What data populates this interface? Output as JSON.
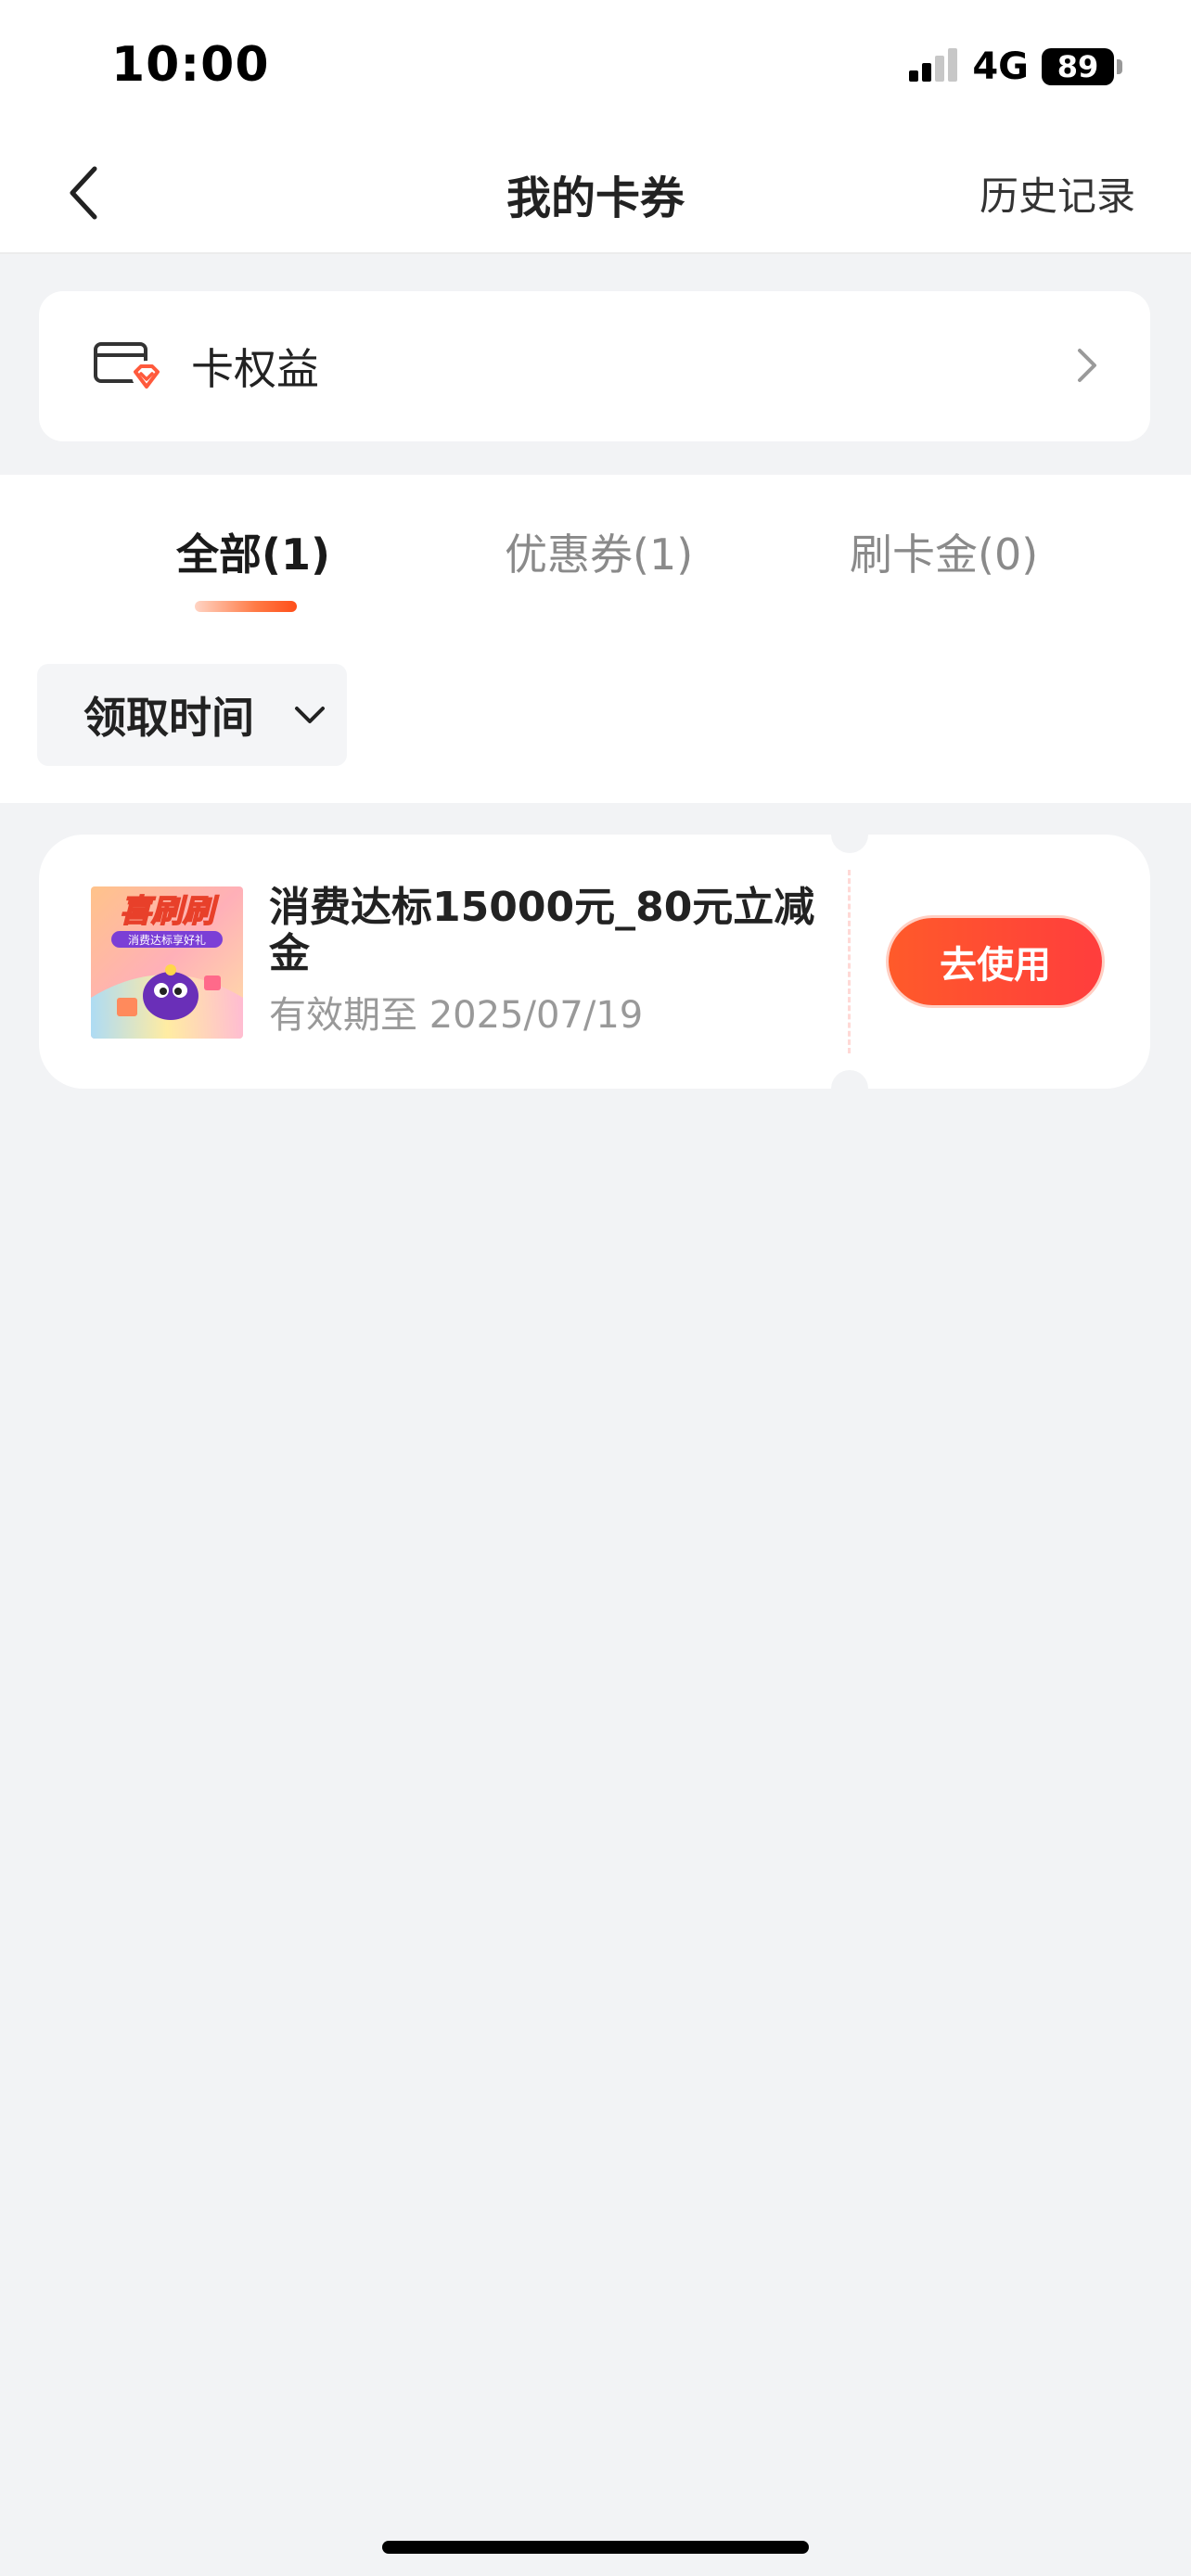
{
  "status_bar": {
    "time": "10:00",
    "network": "4G",
    "battery": "89"
  },
  "nav": {
    "title": "我的卡券",
    "history": "历史记录"
  },
  "rights": {
    "label": "卡权益"
  },
  "tabs": [
    {
      "label": "全部(1)",
      "active": true
    },
    {
      "label": "优惠券(1)",
      "active": false
    },
    {
      "label": "刷卡金(0)",
      "active": false
    }
  ],
  "filter": {
    "label": "领取时间"
  },
  "coupons": [
    {
      "thumb_text": "喜刷刷",
      "thumb_subtext": "消费达标享好礼",
      "title": "消费达标15000元_80元立减金",
      "expiry": "有效期至 2025/07/19",
      "action": "去使用"
    }
  ],
  "colors": {
    "accent": "#ff4f1a",
    "button_start": "#ff5a2a",
    "button_end": "#ff3d3d",
    "background": "#f2f3f5"
  },
  "icons": {
    "back": "chevron-left-icon",
    "rights": "card-rights-icon",
    "rights_arrow": "chevron-right-icon",
    "filter_arrow": "chevron-down-icon"
  }
}
